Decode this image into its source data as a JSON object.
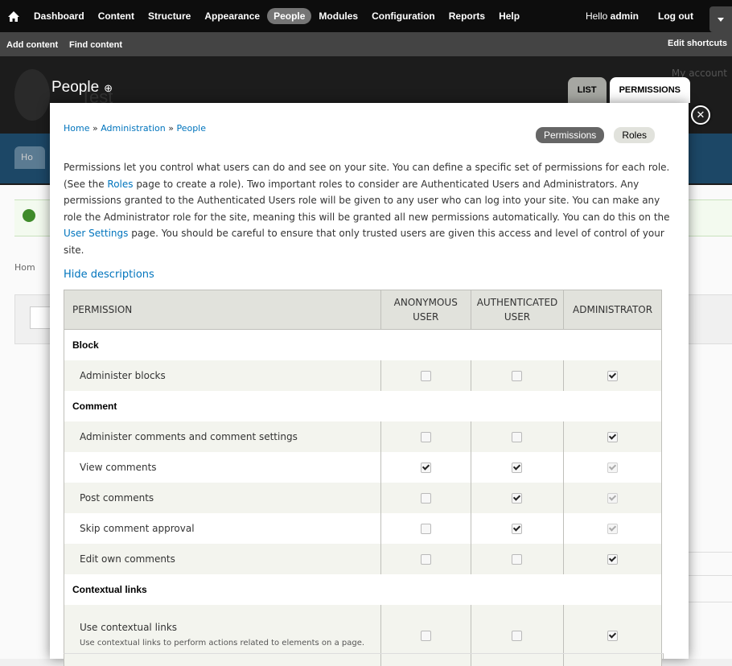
{
  "toolbar": {
    "menu": [
      "Dashboard",
      "Content",
      "Structure",
      "Appearance",
      "People",
      "Modules",
      "Configuration",
      "Reports",
      "Help"
    ],
    "active_item": "People",
    "hello_prefix": "Hello",
    "username": "admin",
    "logout": "Log out",
    "shortcuts": [
      "Add content",
      "Find content"
    ],
    "edit_shortcuts": "Edit shortcuts"
  },
  "background": {
    "page_title": "People",
    "add_icon": "⊕",
    "my_account": "My account",
    "tabs": [
      "LIST",
      "PERMISSIONS"
    ],
    "site_name": "Test",
    "partial_tab": "Ho",
    "partial_breadcrumb": "Hom"
  },
  "dialog": {
    "breadcrumb": [
      "Home",
      "Administration",
      "People"
    ],
    "breadcrumb_sep": "»",
    "secondary_tabs": [
      "Permissions",
      "Roles"
    ],
    "active_secondary_tab": "Permissions",
    "help_1": "Permissions let you control what users can do and see on your site. You can define a specific set of permissions for each role. (See the ",
    "help_link_roles": "Roles",
    "help_2": " page to create a role). Two important roles to consider are Authenticated Users and Administrators. Any permissions granted to the Authenticated Users role will be given to any user who can log into your site. You can make any role the Administrator role for the site, meaning this will be granted all new permissions automatically. You can do this on the ",
    "help_link_settings": "User Settings",
    "help_3": " page. You should be careful to ensure that only trusted users are given this access and level of control of your site.",
    "hide_descriptions": "Hide descriptions",
    "close_icon": "close-icon"
  },
  "table": {
    "headers": {
      "permission": "PERMISSION",
      "anonymous_1": "ANONYMOUS",
      "anonymous_2": "USER",
      "authenticated_1": "AUTHENTICATED",
      "authenticated_2": "USER",
      "administrator": "ADMINISTRATOR"
    },
    "modules": [
      {
        "name": "Block",
        "permissions": [
          {
            "label": "Administer blocks",
            "anonymous": false,
            "authenticated": false,
            "administrator": true,
            "admin_disabled": false
          }
        ]
      },
      {
        "name": "Comment",
        "permissions": [
          {
            "label": "Administer comments and comment settings",
            "anonymous": false,
            "authenticated": false,
            "administrator": true,
            "admin_disabled": false
          },
          {
            "label": "View comments",
            "anonymous": true,
            "authenticated": true,
            "administrator": true,
            "admin_disabled": true
          },
          {
            "label": "Post comments",
            "anonymous": false,
            "authenticated": true,
            "administrator": true,
            "admin_disabled": true
          },
          {
            "label": "Skip comment approval",
            "anonymous": false,
            "authenticated": true,
            "administrator": true,
            "admin_disabled": true
          },
          {
            "label": "Edit own comments",
            "anonymous": false,
            "authenticated": false,
            "administrator": true,
            "admin_disabled": false
          }
        ]
      },
      {
        "name": "Contextual links",
        "permissions": [
          {
            "label": "Use contextual links",
            "description": "Use contextual links to perform actions related to elements on a page.",
            "anonymous": false,
            "authenticated": false,
            "administrator": true,
            "admin_disabled": false
          }
        ]
      }
    ]
  },
  "colors": {
    "toolbar_bg": "#0d0d0d",
    "shortcut_bar_bg": "#444444",
    "link_blue": "#0074bd",
    "header_band_blue": "#1c4766",
    "table_header_bg": "#e1e2dc",
    "row_stripe": "#f3f4ee"
  }
}
